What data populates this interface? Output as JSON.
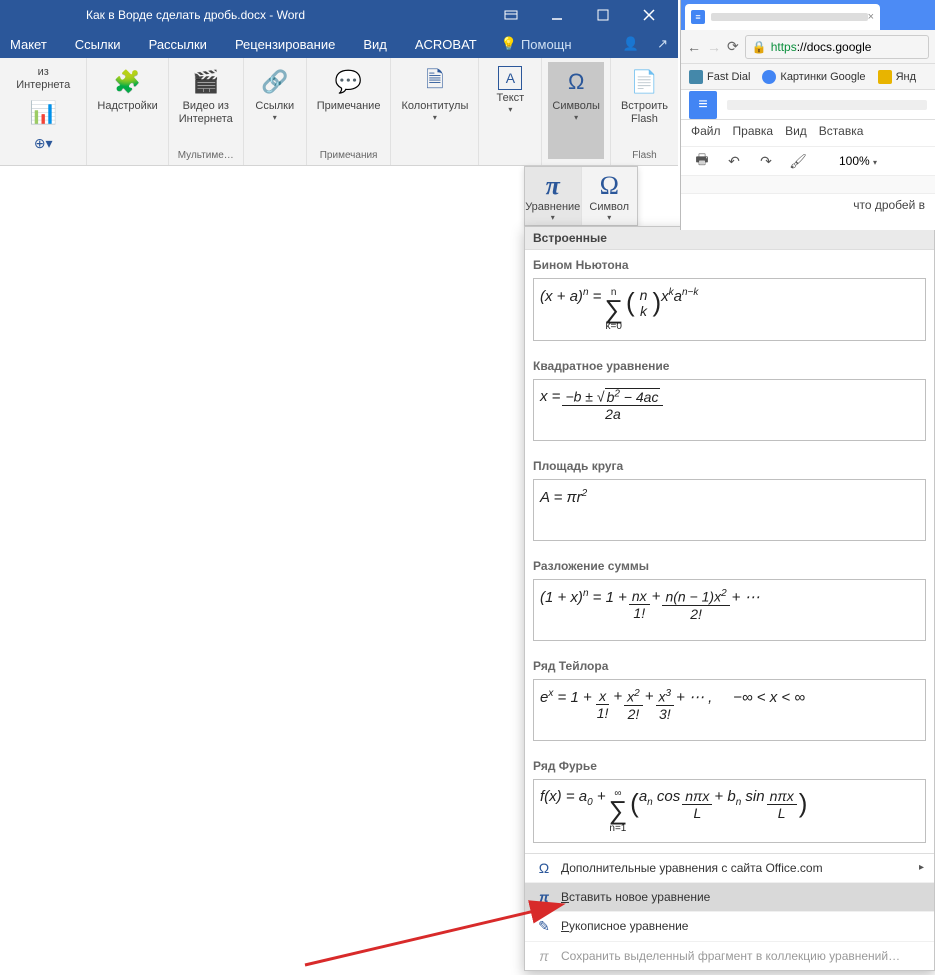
{
  "word": {
    "title": "Как в Ворде сделать дробь.docx - Word",
    "tabs": [
      "Макет",
      "Ссылки",
      "Рассылки",
      "Рецензирование",
      "Вид",
      "ACROBAT"
    ],
    "help_placeholder": "Помощн",
    "ribbon": {
      "internet_label": "из Интернета",
      "groups": {
        "multimedia_label": "Мультиме…",
        "annotations_label": "Примечания",
        "flash_label": "Flash"
      },
      "buttons": {
        "addins": "Надстройки",
        "video": "Видео из\nИнтернета",
        "links": "Ссылки",
        "comment": "Примечание",
        "headers": "Колонтитулы",
        "text": "Текст",
        "symbols": "Символы",
        "flash": "Встроить\nFlash"
      }
    }
  },
  "sym_flyout": {
    "equation": "Уравнение",
    "symbol": "Символ"
  },
  "gallery": {
    "header": "Встроенные",
    "cats": {
      "binom": "Бином Ньютона",
      "quad": "Квадратное уравнение",
      "circle": "Площадь круга",
      "sum": "Разложение суммы",
      "taylor": "Ряд Тейлора",
      "fourier": "Ряд Фурье"
    },
    "footer": {
      "more": "Дополнительные уравнения с сайта Office.com",
      "insert_new": "Вставить новое уравнение",
      "ink": "Рукописное уравнение",
      "save": "Сохранить выделенный фрагмент в коллекцию уравнений…"
    }
  },
  "chrome": {
    "url_https": "https",
    "url_rest": "://docs.google",
    "bookmarks": {
      "fastdial": "Fast Dial",
      "gimg": "Картинки Google",
      "yandex": "Янд"
    },
    "gd_menu": [
      "Файл",
      "Правка",
      "Вид",
      "Вставка"
    ],
    "zoom": "100%",
    "doc_text": "что дробей в"
  }
}
